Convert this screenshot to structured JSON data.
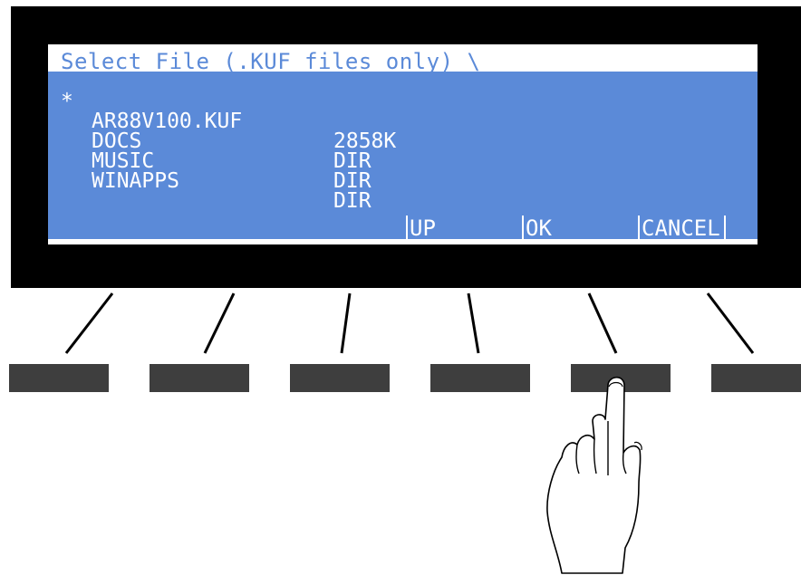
{
  "screen": {
    "title": "Select File (.KUF files only) \\",
    "files": [
      {
        "marker": "*",
        "name": "AR88V100.KUF",
        "info": "2858K"
      },
      {
        "marker": "",
        "name": "DOCS",
        "info": "DIR"
      },
      {
        "marker": "",
        "name": "MUSIC",
        "info": "DIR"
      },
      {
        "marker": "",
        "name": "WINAPPS",
        "info": "DIR"
      }
    ],
    "softkeys": [
      "UP",
      "OK",
      "CANCEL"
    ]
  },
  "colors": {
    "lcd_blue": "#5b8ad8",
    "bezel": "#000000",
    "button": "#3e3e3e"
  },
  "icons": {
    "pointer": "pointing-hand-icon"
  }
}
